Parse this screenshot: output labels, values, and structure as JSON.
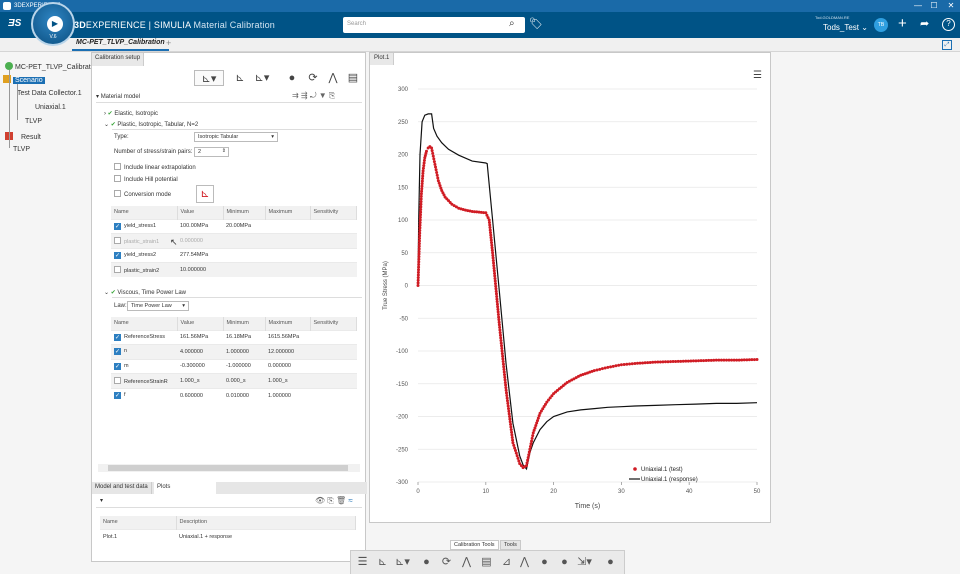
{
  "window": {
    "title": "3DEXPERIENCE",
    "minimize": "—",
    "maximize": "☐",
    "close": "✕"
  },
  "compass": {
    "version": "V.6"
  },
  "header": {
    "brand_prefix": "3D",
    "brand_main": "EXPERIENCE | SIMULIA",
    "app_name": "Material Calibration",
    "search_placeholder": "Search",
    "tenant": "Tod.GOLDMAN.RE",
    "user": "Tods_Test",
    "avatar_initials": "TB"
  },
  "tabs": {
    "active": "MC-PET_TLVP_Calibration",
    "add": "+"
  },
  "tree": {
    "root": "MC-PET_TLVP_Calibrat",
    "scenario": "Scenario",
    "test_data": "Test Data Collector.1",
    "uniaxial": "Uniaxial.1",
    "tlvp_child": "TLVP",
    "result": "Result",
    "tlvp": "TLVP"
  },
  "panel": {
    "tab_label": "Calibration setup",
    "material_model": "Material model",
    "elastic": "Elastic, Isotropic",
    "plastic": "Plastic, Isotropic, Tabular, N=2",
    "type_label": "Type:",
    "type_value": "Isotropic Tabular",
    "pairs_label": "Number of stress/strain pairs:",
    "pairs_value": "2",
    "linear_extrap": "Include linear extrapolation",
    "hill": "Include Hill potential",
    "conversion": "Conversion mode",
    "columns": [
      "Name",
      "Value",
      "Minimum",
      "Maximum",
      "Sensitivity"
    ],
    "plastic_rows": [
      {
        "name": "yield_stress1",
        "value": "100.00MPa",
        "min": "20.00MPa",
        "max": "",
        "checked": true,
        "dim": false
      },
      {
        "name": "plastic_strain1",
        "value": "0.000000",
        "min": "",
        "max": "",
        "checked": false,
        "dim": true
      },
      {
        "name": "yield_stress2",
        "value": "277.54MPa",
        "min": "",
        "max": "",
        "checked": true,
        "dim": false
      },
      {
        "name": "plastic_strain2",
        "value": "10.000000",
        "min": "",
        "max": "",
        "checked": false,
        "dim": false
      }
    ],
    "viscous": "Viscous, Time Power Law",
    "law_label": "Law:",
    "law_value": "Time Power Law",
    "viscous_rows": [
      {
        "name": "ReferenceStress",
        "value": "161.56MPa",
        "min": "16.18MPa",
        "max": "1615.56MPa",
        "checked": true
      },
      {
        "name": "n",
        "value": "4.000000",
        "min": "1.000000",
        "max": "12.000000",
        "checked": true
      },
      {
        "name": "m",
        "value": "-0.300000",
        "min": "-1.000000",
        "max": "0.000000",
        "checked": true
      },
      {
        "name": "ReferenceStrainR",
        "value": "1.000_s",
        "min": "0.000_s",
        "max": "1.000_s",
        "checked": false
      },
      {
        "name": "f",
        "value": "0.600000",
        "min": "0.010000",
        "max": "1.000000",
        "checked": true
      }
    ],
    "bottom_tabs": [
      "Model and test data",
      "Plots"
    ],
    "plots_columns": [
      "Name",
      "Description"
    ],
    "plots_rows": [
      {
        "name": "Plot.1",
        "description": "Uniaxial.1 + response"
      }
    ]
  },
  "plot": {
    "tab_label": "Plot.1"
  },
  "chart_data": {
    "type": "line",
    "title": "",
    "xlabel": "Time (s)",
    "ylabel": "True Stress (MPa)",
    "xlim": [
      0,
      50
    ],
    "ylim": [
      -300,
      300
    ],
    "xticks": [
      0,
      10,
      20,
      30,
      40,
      50
    ],
    "yticks": [
      300,
      250,
      200,
      150,
      100,
      50,
      0,
      -50,
      -100,
      -150,
      -200,
      -250,
      -300
    ],
    "grid": "horizontal",
    "legend_position": "bottom-right",
    "series": [
      {
        "name": "Uniaxial.1 (test)",
        "style": "markers",
        "color": "#d01c24",
        "x": [
          0,
          0.25,
          0.5,
          0.75,
          1.0,
          1.25,
          1.5,
          1.75,
          2.0,
          2.5,
          3,
          3.5,
          4,
          5,
          6,
          7,
          8,
          9,
          10,
          10.5,
          11,
          12,
          13,
          14,
          15,
          15.5,
          16,
          16.5,
          17,
          18,
          19,
          20,
          22,
          24,
          26,
          28,
          30,
          32,
          35,
          38,
          41,
          44,
          47,
          50
        ],
        "y": [
          0,
          80,
          140,
          175,
          195,
          205,
          210,
          212,
          210,
          185,
          160,
          145,
          135,
          124,
          118,
          115,
          113,
          112,
          111,
          100,
          50,
          -60,
          -160,
          -240,
          -272,
          -278,
          -275,
          -250,
          -225,
          -195,
          -178,
          -165,
          -148,
          -137,
          -130,
          -125,
          -121,
          -119,
          -117,
          -116,
          -115,
          -114,
          -114,
          -113
        ]
      },
      {
        "name": "Uniaxial.1 (response)",
        "style": "line",
        "color": "#111111",
        "x": [
          0,
          0.1,
          0.3,
          0.6,
          1.0,
          1.5,
          2.0,
          2.3,
          2.8,
          3.5,
          4.5,
          6,
          8,
          10,
          10.2,
          11,
          12,
          13,
          14,
          15,
          15.5,
          16,
          16.5,
          17,
          18,
          19,
          20,
          22,
          24,
          26,
          28,
          30,
          32,
          35,
          38,
          41,
          44,
          47,
          50
        ],
        "y": [
          0,
          100,
          200,
          250,
          260,
          262,
          262,
          240,
          228,
          218,
          208,
          199,
          190,
          187,
          186,
          100,
          -10,
          -120,
          -210,
          -260,
          -274,
          -280,
          -255,
          -240,
          -220,
          -208,
          -200,
          -193,
          -190,
          -188,
          -186,
          -185,
          -184,
          -183,
          -182,
          -181,
          -180,
          -180,
          -179
        ]
      }
    ]
  }
}
